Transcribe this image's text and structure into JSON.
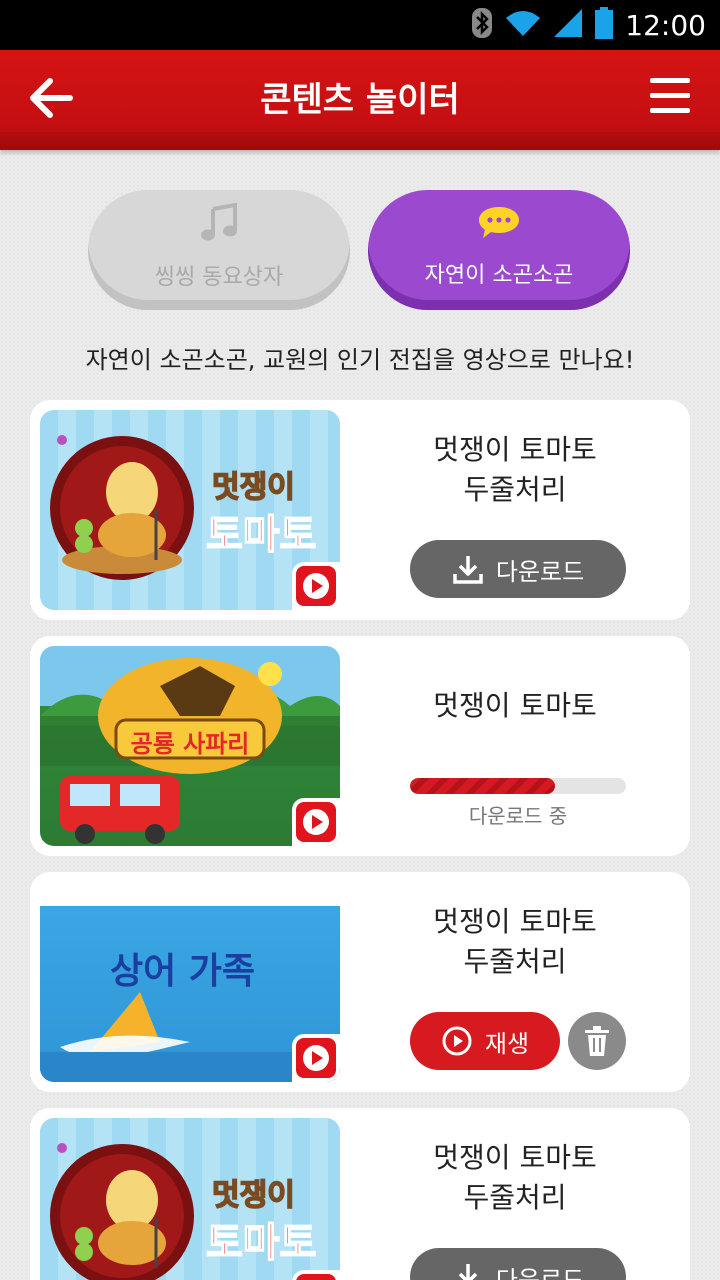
{
  "status_bar": {
    "time": "12:00"
  },
  "app_bar": {
    "title": "콘텐츠 놀이터"
  },
  "tabs": [
    {
      "label": "씽씽 동요상자",
      "icon": "music-note-icon",
      "active": false
    },
    {
      "label": "자연이 소곤소곤",
      "icon": "chat-bubble-icon",
      "active": true
    }
  ],
  "subtitle": "자연이 소곤소곤, 교원의 인기 전집을 영상으로 만나요!",
  "cards": [
    {
      "title_line1": "멋쟁이 토마토",
      "title_line2": "두줄처리",
      "state": "download",
      "button_label": "다운로드",
      "thumb_text_1": "멋쟁이",
      "thumb_text_2": "토마토"
    },
    {
      "title_line1": "멋쟁이 토마토",
      "state": "downloading",
      "progress": 0.67,
      "progress_label": "다운로드 중",
      "thumb_text_1": "공룡 사파리"
    },
    {
      "title_line1": "멋쟁이 토마토",
      "title_line2": "두줄처리",
      "state": "downloaded",
      "button_label": "재생",
      "thumb_text_1": "상어 가족"
    },
    {
      "title_line1": "멋쟁이 토마토",
      "title_line2": "두줄처리",
      "state": "download",
      "button_label": "다운로드",
      "thumb_text_1": "멋쟁이",
      "thumb_text_2": "토마토"
    }
  ],
  "colors": {
    "app_bar": "#c60f12",
    "tab_active": "#9b4ad0",
    "tab_inactive": "#d7d7d7",
    "download_button": "#666666",
    "play_button": "#d71a20",
    "delete_button": "#8a8a8a"
  }
}
